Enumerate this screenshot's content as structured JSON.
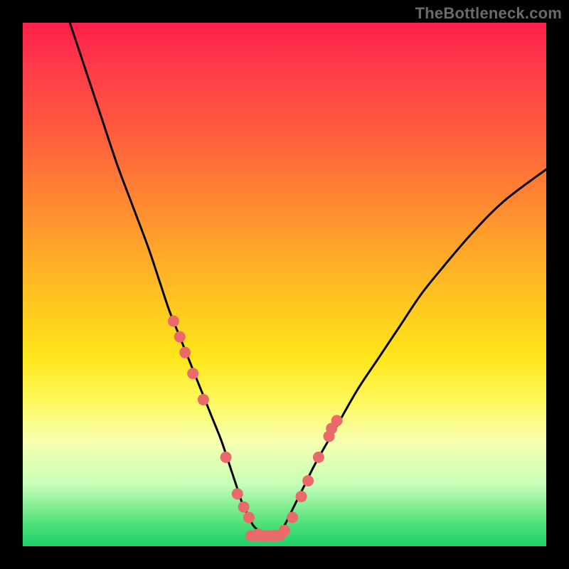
{
  "watermark": "TheBottleneck.com",
  "chart_data": {
    "type": "line",
    "title": "",
    "xlabel": "",
    "ylabel": "",
    "xlim": [
      0,
      100
    ],
    "ylim": [
      0,
      100
    ],
    "grid": false,
    "legend": false,
    "series": [
      {
        "name": "bottleneck-curve",
        "color": "#000000",
        "x": [
          9,
          12,
          15,
          18,
          21,
          24,
          26,
          28,
          30,
          32,
          34,
          36,
          38,
          40,
          41,
          42,
          43,
          44,
          45,
          46,
          47,
          48,
          49,
          50,
          52,
          54,
          56,
          60,
          64,
          68,
          72,
          76,
          80,
          86,
          92,
          100
        ],
        "values": [
          100,
          91,
          82,
          73,
          65,
          57,
          51,
          45,
          40,
          35,
          30,
          25,
          20,
          14,
          11,
          8,
          6,
          4,
          3,
          2,
          2,
          2,
          3,
          4,
          8,
          12,
          16,
          23,
          30,
          36,
          42,
          48,
          53,
          60,
          66,
          72
        ]
      }
    ],
    "scatter_points": {
      "name": "highlighted-points",
      "color": "#ea6a6a",
      "radius_px": 8,
      "x": [
        28.8,
        30.0,
        31.0,
        32.5,
        34.5,
        38.8,
        41.0,
        42.2,
        43.2,
        45.0,
        46.5,
        48.0,
        49.2,
        50.0,
        51.5,
        53.2,
        54.5,
        56.5,
        58.5,
        59.0,
        60.0
      ],
      "y": [
        43.0,
        40.0,
        37.0,
        33.0,
        28.0,
        17.0,
        10.0,
        7.5,
        5.5,
        2.3,
        2.0,
        2.0,
        2.2,
        3.0,
        5.5,
        9.5,
        12.5,
        17.0,
        21.0,
        22.5,
        24.0
      ]
    },
    "bottom_bar": {
      "name": "plateau-bar",
      "color": "#ea6a6a",
      "x_start": 42.5,
      "x_end": 50.0,
      "y": 2.0,
      "thickness_px": 15
    }
  }
}
